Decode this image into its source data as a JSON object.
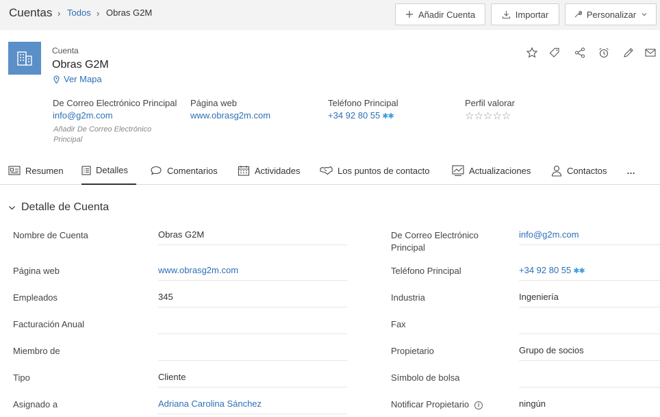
{
  "breadcrumb": {
    "module": "Cuentas",
    "list_link": "Todos",
    "current": "Obras G2M"
  },
  "toolbar": {
    "add_label": "Añadir Cuenta",
    "import_label": "Importar",
    "customize_label": "Personalizar"
  },
  "record": {
    "type_label": "Cuenta",
    "name": "Obras G2M",
    "map_link": "Ver Mapa",
    "summary_fields": {
      "email_label": "De Correo Electrónico Principal",
      "email_value": "info@g2m.com",
      "email_hint": "Añadir De Correo Electrónico Principal",
      "website_label": "Página web",
      "website_value": "www.obrasg2m.com",
      "phone_label": "Teléfono Principal",
      "phone_value": "+34 92 80 55",
      "rating_label": "Perfil valorar",
      "rating_stars": "☆☆☆☆☆"
    }
  },
  "tabs": [
    {
      "label": "Resumen",
      "icon": "summary-icon"
    },
    {
      "label": "Detalles",
      "icon": "details-icon",
      "active": true
    },
    {
      "label": "Comentarios",
      "icon": "comments-icon"
    },
    {
      "label": "Actividades",
      "icon": "calendar-icon"
    },
    {
      "label": "Los puntos de contacto",
      "icon": "handshake-icon"
    },
    {
      "label": "Actualizaciones",
      "icon": "chart-icon"
    },
    {
      "label": "Contactos",
      "icon": "person-icon"
    },
    {
      "label": "…",
      "icon": "more-icon"
    }
  ],
  "section": {
    "title": "Detalle de Cuenta",
    "left": [
      {
        "label": "Nombre de Cuenta",
        "value": "Obras G2M"
      },
      {
        "label": "Página web",
        "value": "www.obrasg2m.com"
      },
      {
        "label": "Empleados",
        "value": "345"
      },
      {
        "label": "Facturación Anual",
        "value": ""
      },
      {
        "label": "Miembro de",
        "value": ""
      },
      {
        "label": "Tipo",
        "value": "Cliente"
      },
      {
        "label": "Asignado a",
        "value": "Adriana Carolina Sánchez"
      }
    ],
    "right": [
      {
        "label": "De Correo Electrónico Principal",
        "value": "info@g2m.com"
      },
      {
        "label": "Teléfono Principal",
        "value": "+34 92 80 55"
      },
      {
        "label": "Industria",
        "value": "Ingeniería"
      },
      {
        "label": "Fax",
        "value": ""
      },
      {
        "label": "Propietario",
        "value": "Grupo de socios"
      },
      {
        "label": "Símbolo de bolsa",
        "value": ""
      },
      {
        "label": "Notificar Propietario",
        "value": "ningún"
      }
    ]
  },
  "colors": {
    "link": "#2d6fb8",
    "avatar": "#5a8fc7",
    "topbar": "#f3f3f3"
  }
}
